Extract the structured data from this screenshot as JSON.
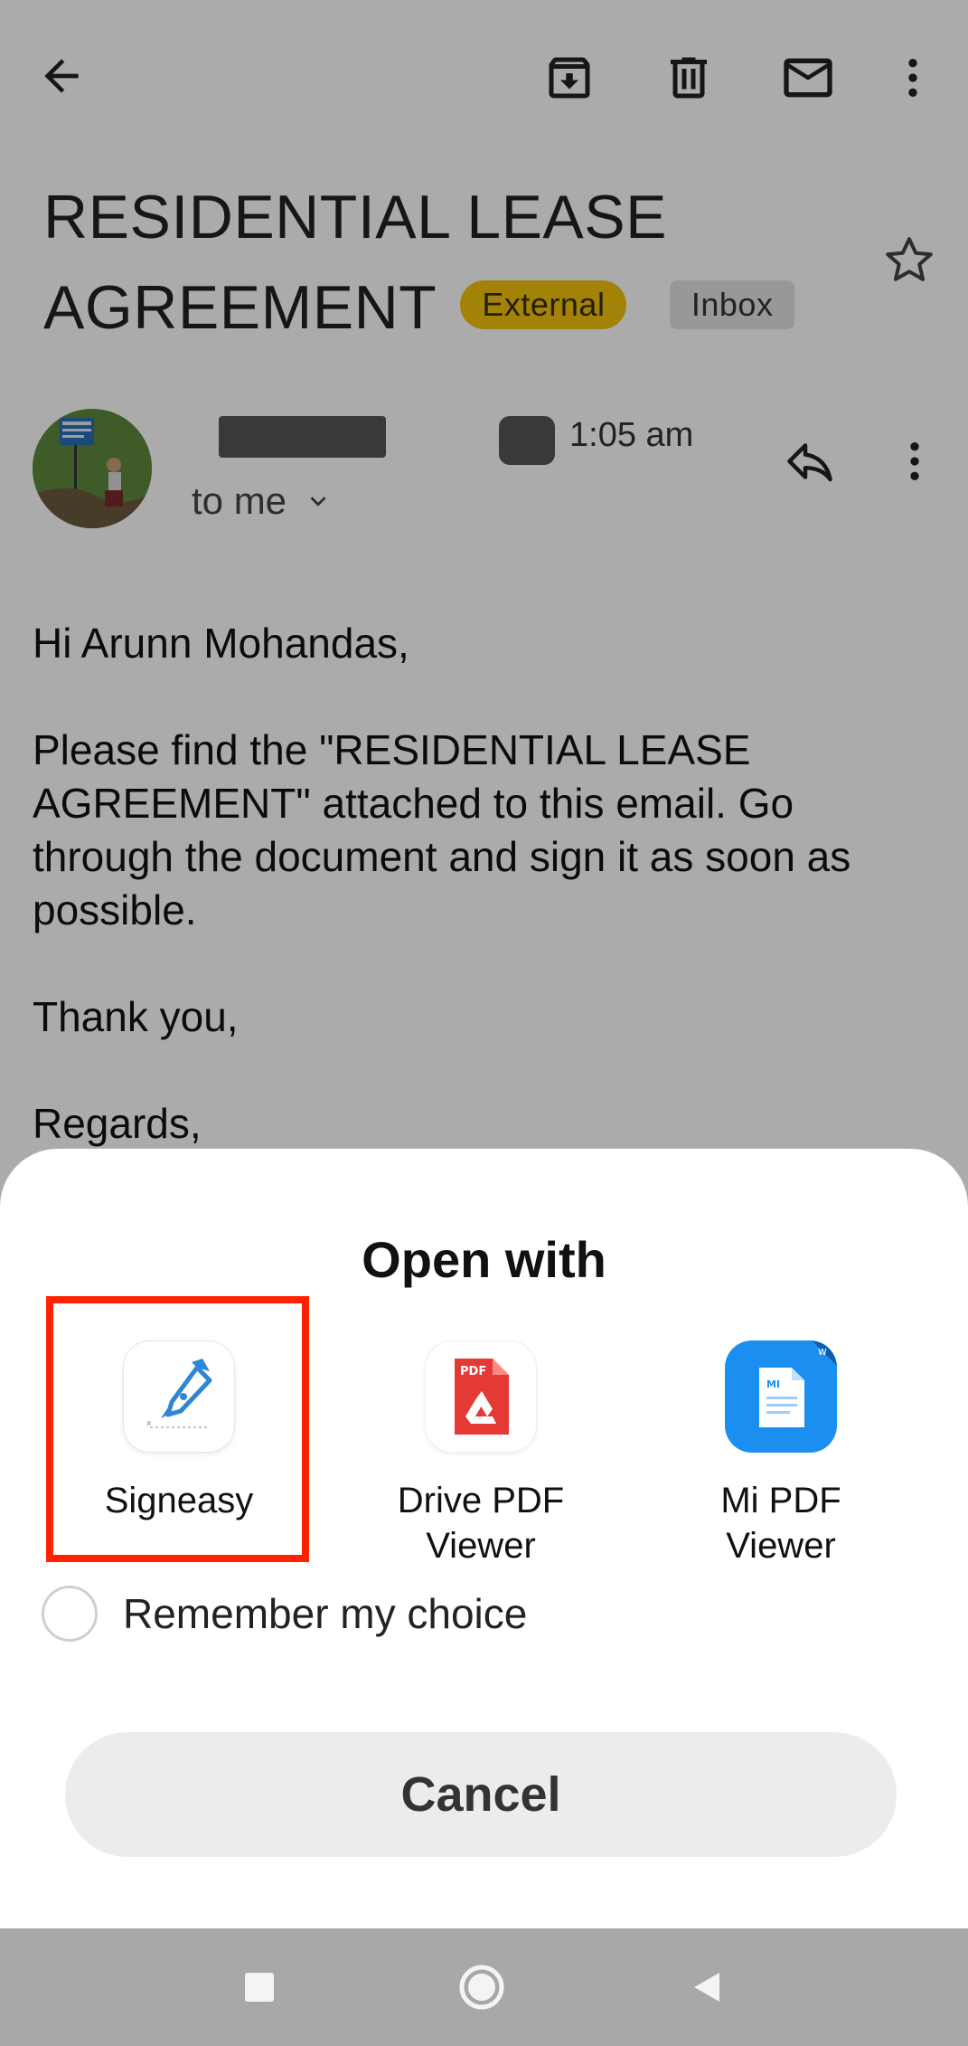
{
  "email": {
    "subject": "RESIDENTIAL LEASE AGREEMENT",
    "labels": {
      "external": "External",
      "inbox": "Inbox"
    },
    "time": "1:05 am",
    "recipient": "to me",
    "body": {
      "greeting": "Hi Arunn Mohandas,",
      "paragraph": "Please find the \"RESIDENTIAL LEASE AGREEMENT\" attached to this email. Go through the document and sign it as soon as possible.",
      "thanks": "Thank you,",
      "regards": "Regards,"
    }
  },
  "toolbar": {
    "icons": [
      "back-arrow-icon",
      "archive-icon",
      "delete-icon",
      "mail-icon",
      "more-vert-icon"
    ]
  },
  "sheet": {
    "title": "Open with",
    "apps": [
      {
        "name": "Signeasy",
        "icon": "signeasy-pen-icon"
      },
      {
        "name": "Drive PDF Viewer",
        "icon": "drive-pdf-icon"
      },
      {
        "name": "Mi PDF Viewer",
        "icon": "mi-pdf-icon"
      }
    ],
    "remember_label": "Remember my choice",
    "cancel_label": "Cancel"
  },
  "colors": {
    "external_badge": "#f4c20d",
    "highlight": "#ff2200",
    "mi_pdf_blue": "#1a8ff0",
    "drive_pdf_red": "#e53935"
  }
}
